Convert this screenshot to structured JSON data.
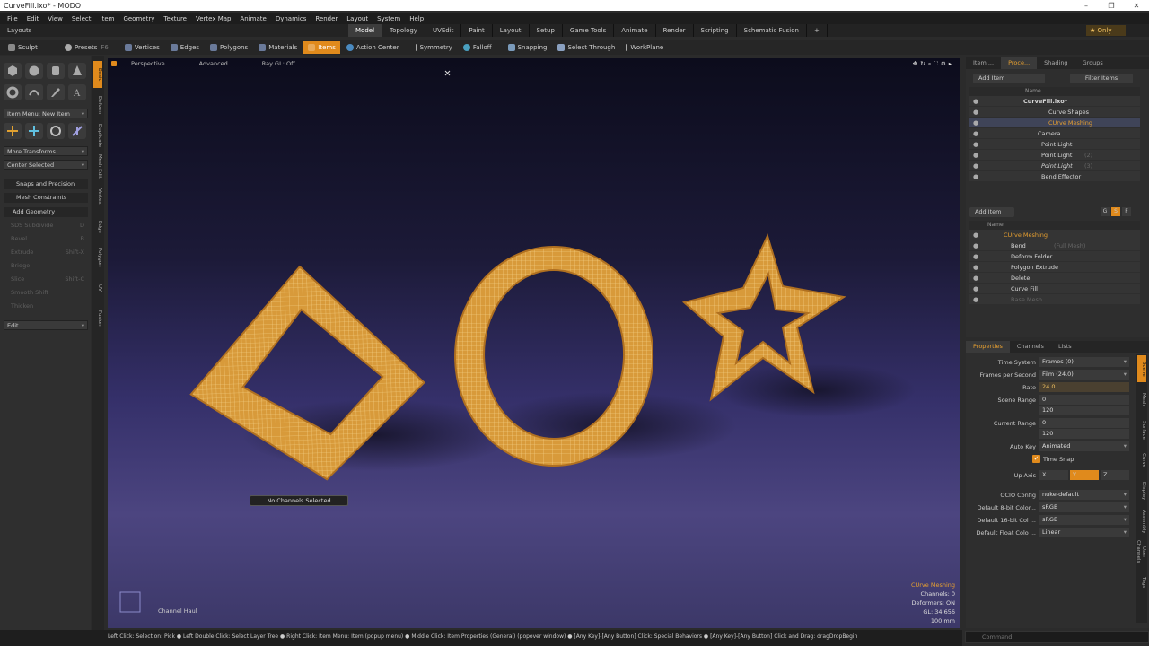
{
  "window": {
    "title": "CurveFill.lxo* - MODO",
    "min": "–",
    "max": "❐",
    "close": "✕"
  },
  "menu": [
    "File",
    "Edit",
    "View",
    "Select",
    "Item",
    "Geometry",
    "Texture",
    "Vertex Map",
    "Animate",
    "Dynamics",
    "Render",
    "Layout",
    "System",
    "Help"
  ],
  "layouts": {
    "label": "Layouts",
    "tabs": [
      "Model",
      "Topology",
      "UVEdit",
      "Paint",
      "Layout",
      "Setup",
      "Game Tools",
      "Animate",
      "Render",
      "Scripting",
      "Schematic Fusion"
    ],
    "active": "Model",
    "plus": "+",
    "only": "★  Only"
  },
  "toolbar": {
    "sculpt": "Sculpt",
    "presets": "Presets",
    "presets_key": "F6",
    "modes": [
      "Vertices",
      "Edges",
      "Polygons",
      "Materials",
      "Items"
    ],
    "active_mode": "Items",
    "action_center": "Action Center",
    "symmetry": "Symmetry",
    "falloff": "Falloff",
    "snapping": "Snapping",
    "select_through": "Select Through",
    "workplane": "WorkPlane"
  },
  "left": {
    "item_menu": "Item Menu: New Item",
    "more_transforms": "More Transforms",
    "center_selected": "Center Selected",
    "snaps": "Snaps and Precision",
    "mesh_constraints": "Mesh Constraints",
    "add_geometry": "Add Geometry",
    "dim_items": [
      {
        "label": "SDS Subdivide",
        "key": "D"
      },
      {
        "label": "Bevel",
        "key": "B"
      },
      {
        "label": "Extrude",
        "key": "Shift-X"
      },
      {
        "label": "Bridge",
        "key": ""
      },
      {
        "label": "Slice",
        "key": "Shift-C"
      },
      {
        "label": "Smooth Shift",
        "key": ""
      },
      {
        "label": "Thicken",
        "key": ""
      }
    ],
    "edit": "Edit",
    "vtabs": [
      "Basic",
      "Deform",
      "Duplicate",
      "Mesh Edit",
      "Vertex",
      "Edge",
      "Polygon",
      "UV",
      "Fusion"
    ]
  },
  "viewport": {
    "view": "Perspective",
    "mode": "Advanced",
    "raygl": "Ray GL: Off",
    "tooltip": "No Channels Selected",
    "channel_haul": "Channel Haul",
    "info": {
      "item": "CUrve Meshing",
      "channels": "Channels: 0",
      "deformers": "Deformers: ON",
      "gl": "GL: 34,656",
      "scale": "100 mm"
    }
  },
  "status": "Left Click: Selection: Pick ● Left Double Click: Select Layer Tree ● Right Click: Item Menu: Item (popup menu) ● Middle Click: Item Properties (General) (popover window) ● [Any Key]-[Any Button] Click: Special Behaviors ● [Any Key]-[Any Button] Click and Drag: dragDropBegin",
  "command": "Command",
  "items_panel": {
    "tabs": [
      "Item ...",
      "Proce...",
      "Shading",
      "Groups"
    ],
    "active": "Proce...",
    "add_item": "Add Item",
    "filter": "Filter Items",
    "name_col": "Name",
    "rows": [
      {
        "label": "CurveFill.lxo*",
        "indent": 60,
        "bold": true
      },
      {
        "label": "Curve Shapes",
        "indent": 88
      },
      {
        "label": "CUrve Meshing",
        "indent": 88,
        "orange": true,
        "sel": true
      },
      {
        "label": "Camera",
        "indent": 76
      },
      {
        "label": "Point Light",
        "indent": 80
      },
      {
        "label": "Point Light",
        "indent": 80,
        "suffix": "(2)"
      },
      {
        "label": "Point Light",
        "indent": 80,
        "suffix": "(3)",
        "italic": true
      },
      {
        "label": "Bend Effector",
        "indent": 80
      }
    ]
  },
  "deformers_panel": {
    "add_item": "Add Item",
    "name_col": "Name",
    "buttons": [
      "G",
      "S",
      "F"
    ],
    "rows": [
      {
        "label": "CUrve Meshing",
        "indent": 38,
        "orange": true
      },
      {
        "label": "Bend",
        "indent": 46,
        "suffix": "(Full Mesh)"
      },
      {
        "label": "Deform Folder",
        "indent": 46
      },
      {
        "label": "Polygon Extrude",
        "indent": 46
      },
      {
        "label": "Delete",
        "indent": 46
      },
      {
        "label": "Curve Fill",
        "indent": 46
      },
      {
        "label": "Base Mesh",
        "indent": 46,
        "dim": true
      }
    ]
  },
  "properties": {
    "tabs": [
      "Properties",
      "Channels",
      "Lists"
    ],
    "active": "Properties",
    "rows": [
      {
        "label": "Time System",
        "value": "Frames (0)",
        "dd": true
      },
      {
        "label": "Frames per Second",
        "value": "Film (24.0)",
        "dd": true
      },
      {
        "label": "Rate",
        "value": "24.0",
        "hl": true
      },
      {
        "label": "Scene Range",
        "value": "0",
        "value2": "120"
      },
      {
        "label": "Current Range",
        "value": "0",
        "value2": "120"
      },
      {
        "label": "Auto Key",
        "value": "Animated",
        "dd": true
      },
      {
        "label": "",
        "value": "Time Snap",
        "check": true
      },
      {
        "label": "Up Axis",
        "axis": [
          "X",
          "Y",
          "Z"
        ],
        "axis_active": "Y"
      },
      {
        "label": "OCIO Config",
        "value": "nuke-default",
        "dd": true
      },
      {
        "label": "Default 8-bit Color...",
        "value": "sRGB",
        "dd": true
      },
      {
        "label": "Default 16-bit Col ...",
        "value": "sRGB",
        "dd": true
      },
      {
        "label": "Default Float Colo ...",
        "value": "Linear",
        "dd": true
      }
    ],
    "vtabs": [
      "Scene",
      "Mesh",
      "Surface",
      "Curve",
      "Display",
      "Assembly",
      "User Channels",
      "Tags"
    ]
  }
}
